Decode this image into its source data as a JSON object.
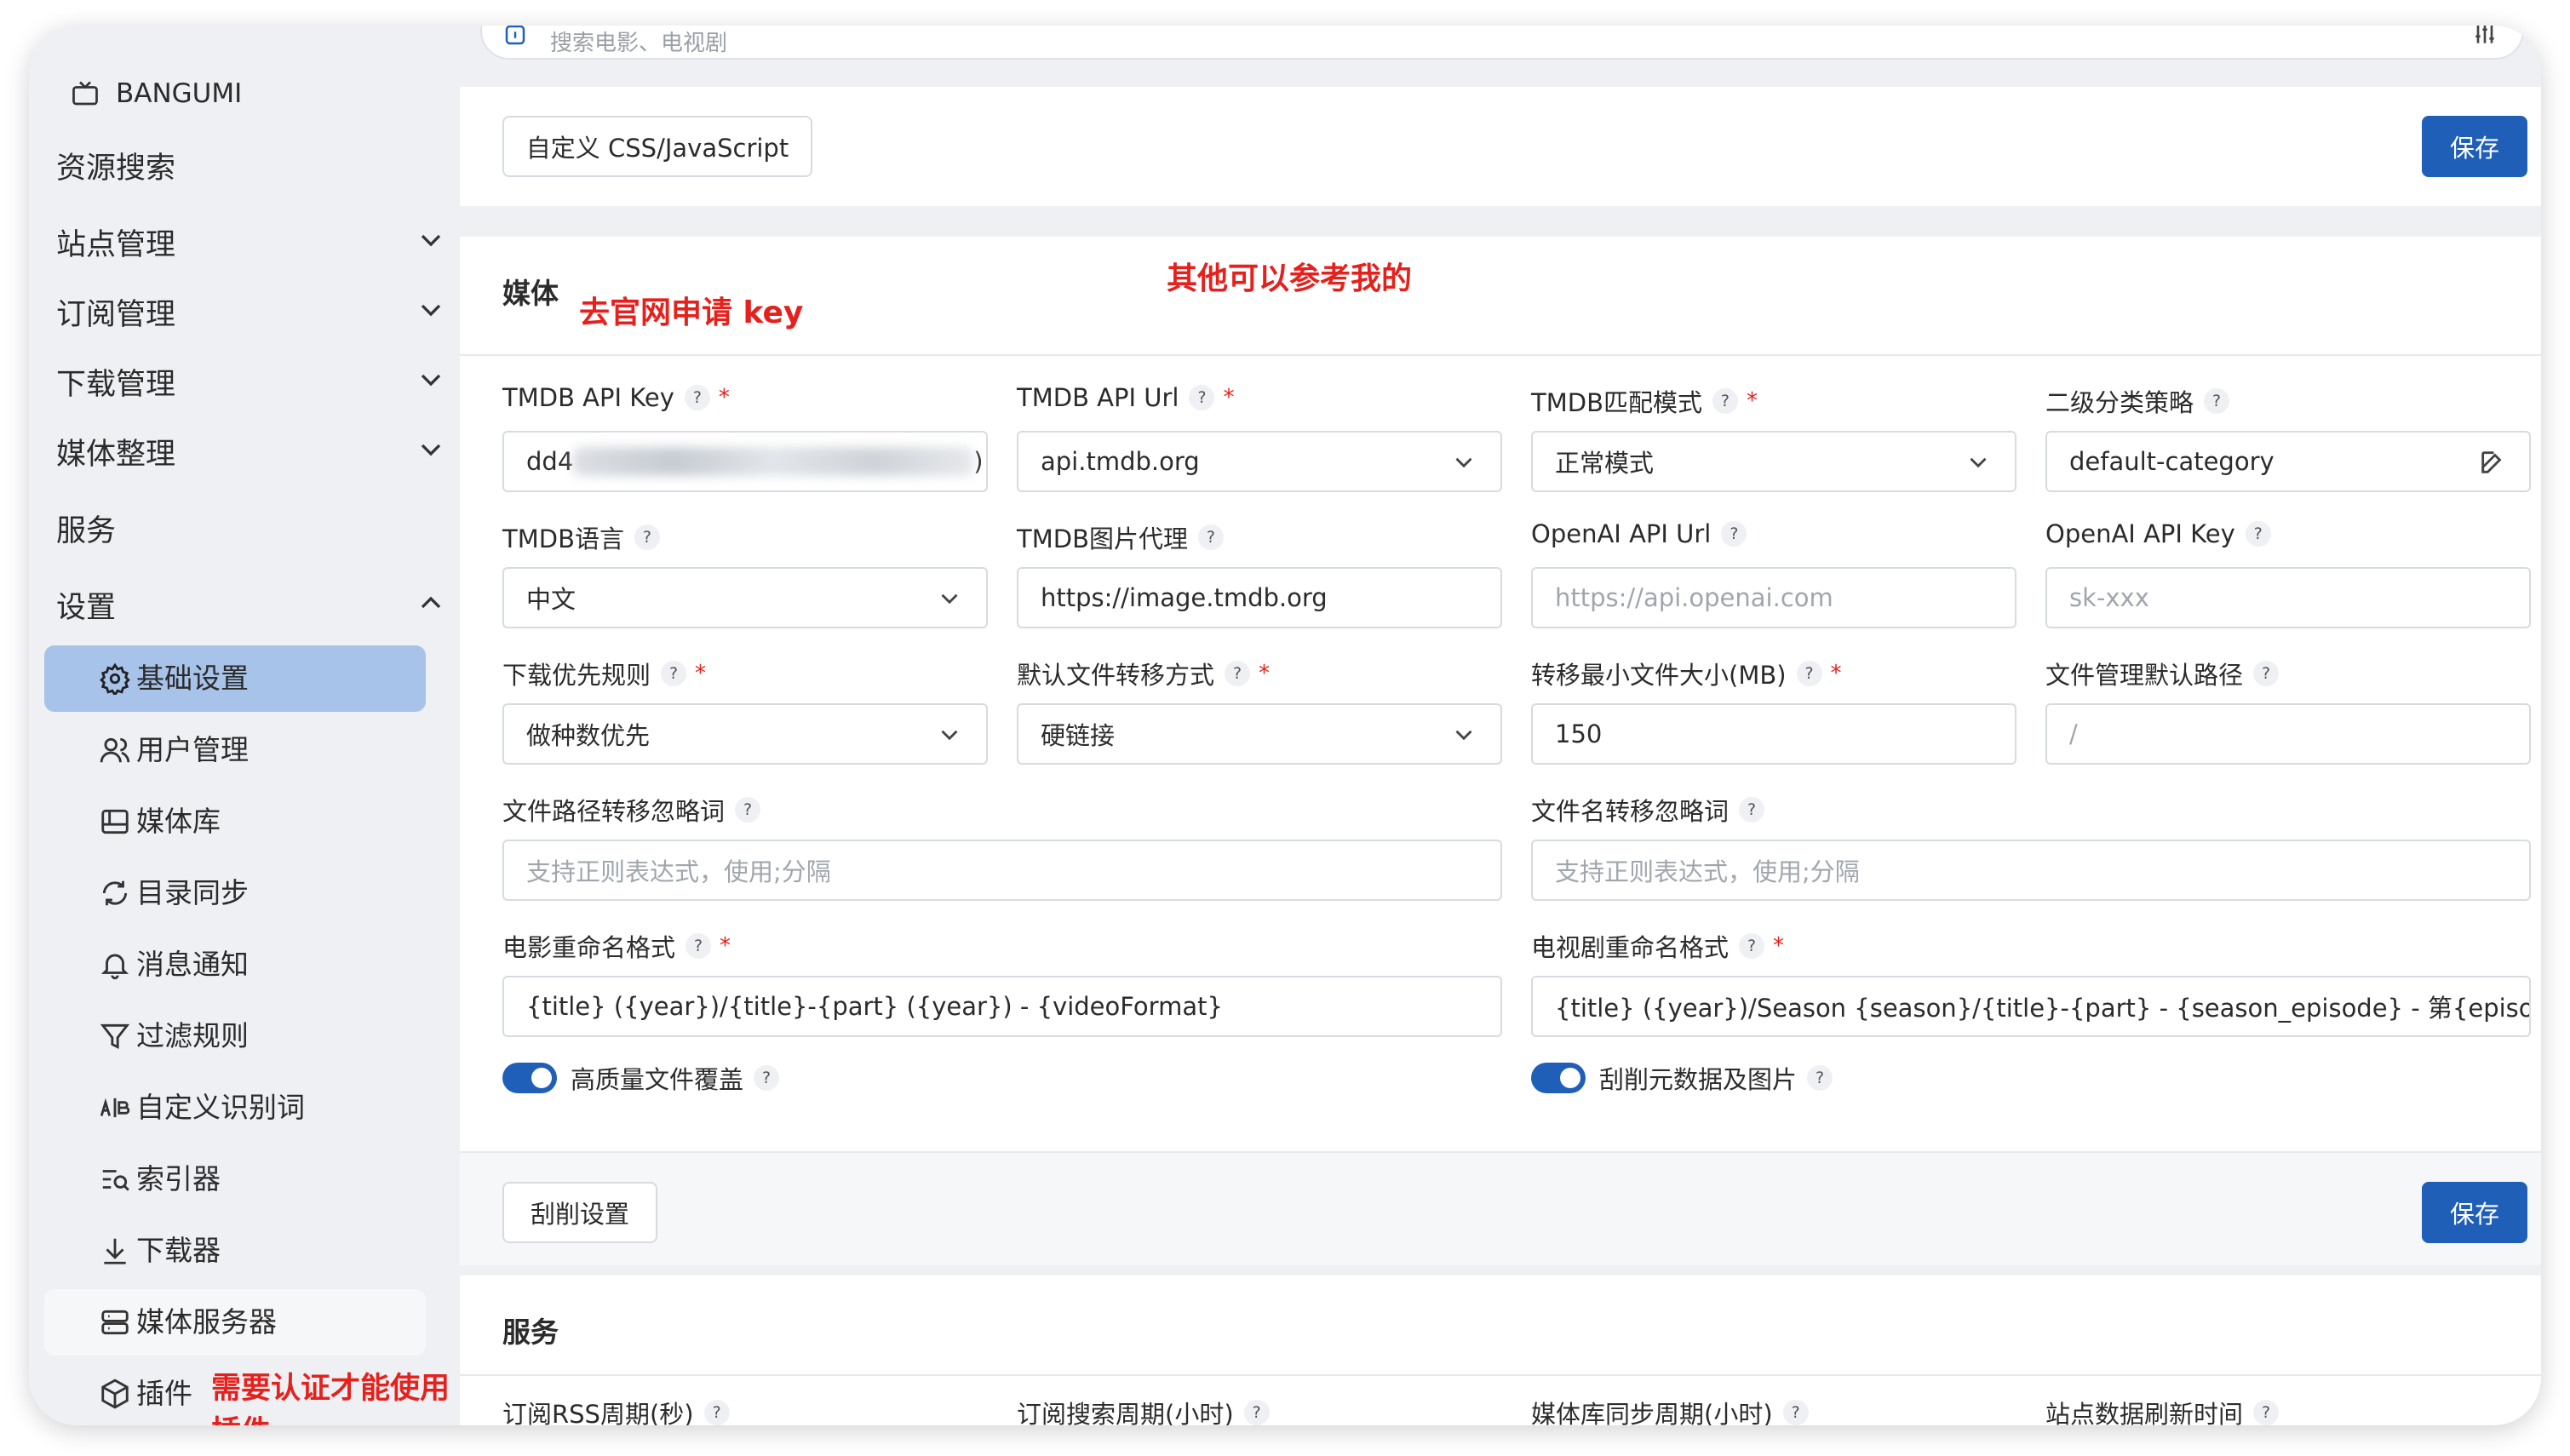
{
  "sidebar": {
    "top_label": "BANGUMI",
    "resource_search": "资源搜索",
    "site_mgmt": "站点管理",
    "sub_mgmt": "订阅管理",
    "dl_mgmt": "下载管理",
    "media_org": "媒体整理",
    "service": "服务",
    "settings": "设置",
    "items": [
      {
        "label": "基础设置",
        "icon": "gear-icon"
      },
      {
        "label": "用户管理",
        "icon": "users-icon"
      },
      {
        "label": "媒体库",
        "icon": "library-icon"
      },
      {
        "label": "目录同步",
        "icon": "sync-icon"
      },
      {
        "label": "消息通知",
        "icon": "bell-icon"
      },
      {
        "label": "过滤规则",
        "icon": "filter-icon"
      },
      {
        "label": "自定义识别词",
        "icon": "ab-icon"
      },
      {
        "label": "索引器",
        "icon": "indexer-icon"
      },
      {
        "label": "下载器",
        "icon": "download-icon"
      },
      {
        "label": "媒体服务器",
        "icon": "server-icon"
      },
      {
        "label": "插件",
        "icon": "plugin-icon"
      }
    ]
  },
  "search": {
    "placeholder": "搜索电影、电视剧"
  },
  "top_card": {
    "custom_btn": "自定义 CSS/JavaScript",
    "save": "保存"
  },
  "media": {
    "title": "媒体",
    "annotation_key": "去官网申请 key",
    "annotation_ref": "其他可以参考我的",
    "fields": {
      "tmdb_key_label": "TMDB API Key",
      "tmdb_key_value_prefix": "dd4",
      "tmdb_key_value_suffix": ")",
      "tmdb_url_label": "TMDB API Url",
      "tmdb_url_value": "api.tmdb.org",
      "tmdb_match_label": "TMDB匹配模式",
      "tmdb_match_value": "正常模式",
      "category_label": "二级分类策略",
      "category_value": "default-category",
      "lang_label": "TMDB语言",
      "lang_value": "中文",
      "img_proxy_label": "TMDB图片代理",
      "img_proxy_value": "https://image.tmdb.org",
      "openai_url_label": "OpenAI API Url",
      "openai_url_ph": "https://api.openai.com",
      "openai_key_label": "OpenAI API Key",
      "openai_key_ph": "sk-xxx",
      "dl_rule_label": "下载优先规则",
      "dl_rule_value": "做种数优先",
      "transfer_label": "默认文件转移方式",
      "transfer_value": "硬链接",
      "min_size_label": "转移最小文件大小(MB)",
      "min_size_value": "150",
      "file_path_label": "文件管理默认路径",
      "file_path_ph": "/",
      "path_ignore_label": "文件路径转移忽略词",
      "path_ignore_ph": "支持正则表达式，使用;分隔",
      "name_ignore_label": "文件名转移忽略词",
      "name_ignore_ph": "支持正则表达式，使用;分隔",
      "movie_fmt_label": "电影重命名格式",
      "movie_fmt_value": "{title} ({year})/{title}-{part} ({year}) - {videoFormat}",
      "tv_fmt_label": "电视剧重命名格式",
      "tv_fmt_value": "{title} ({year})/Season {season}/{title}-{part} - {season_episode} - 第{episode}集",
      "hq_label": "高质量文件覆盖",
      "scrape_label": "刮削元数据及图片"
    },
    "scrape_btn": "刮削设置",
    "save": "保存"
  },
  "service_card": {
    "title": "服务",
    "annotation_plugin": "需要认证才能使用插件",
    "labels": [
      "订阅RSS周期(秒)",
      "订阅搜索周期(小时)",
      "媒体库同步周期(小时)",
      "站点数据刷新时间"
    ]
  },
  "colors": {
    "primary": "#1f5fb8",
    "active": "#a7c3ea",
    "annotation": "#e5211d"
  }
}
